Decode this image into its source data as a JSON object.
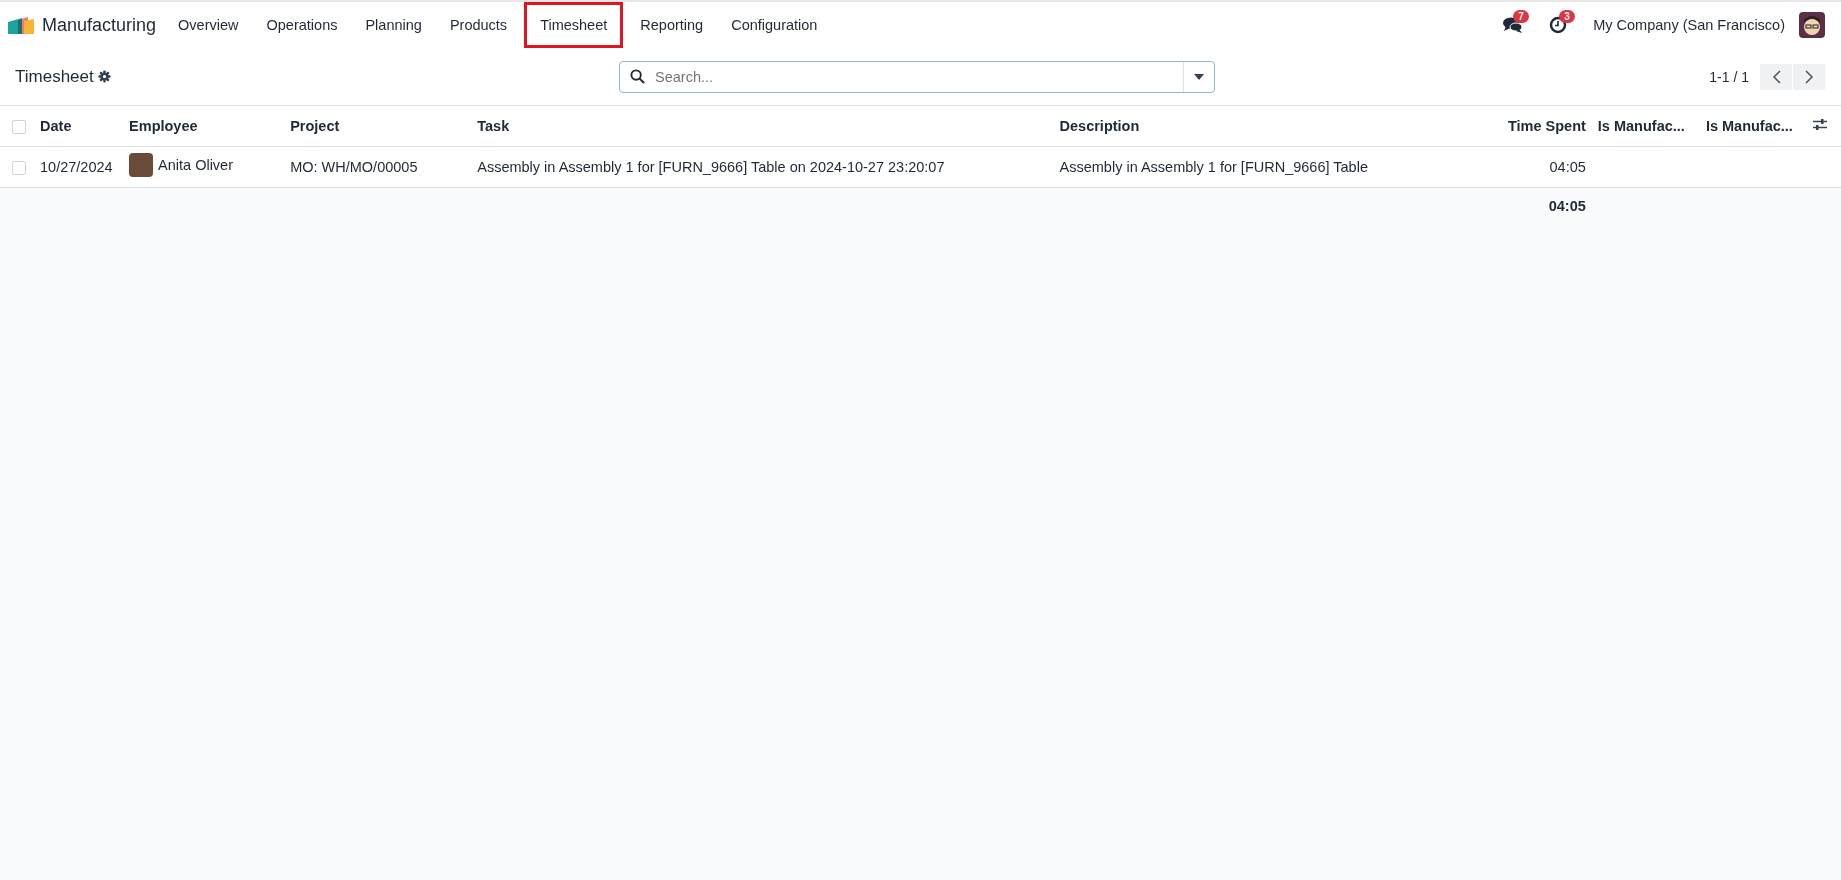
{
  "navbar": {
    "app_name": "Manufacturing",
    "menu": [
      {
        "label": "Overview",
        "highlighted": false
      },
      {
        "label": "Operations",
        "highlighted": false
      },
      {
        "label": "Planning",
        "highlighted": false
      },
      {
        "label": "Products",
        "highlighted": false
      },
      {
        "label": "Timesheet",
        "highlighted": true
      },
      {
        "label": "Reporting",
        "highlighted": false
      },
      {
        "label": "Configuration",
        "highlighted": false
      }
    ],
    "messages_badge": "7",
    "activities_badge": "3",
    "company": "My Company (San Francisco)"
  },
  "control_panel": {
    "title": "Timesheet",
    "search": {
      "placeholder": "Search..."
    },
    "pager": "1-1 / 1"
  },
  "table": {
    "columns": [
      {
        "label": "Date",
        "kind": "text"
      },
      {
        "label": "Employee",
        "kind": "text"
      },
      {
        "label": "Project",
        "kind": "text"
      },
      {
        "label": "Task",
        "kind": "text"
      },
      {
        "label": "Description",
        "kind": "text"
      },
      {
        "label": "Time Spent",
        "kind": "duration"
      },
      {
        "label": "Is Manufac...",
        "kind": "text"
      },
      {
        "label": "Is Manufac...",
        "kind": "text"
      }
    ],
    "all_selected": false,
    "rows": [
      {
        "checked": false,
        "date": "10/27/2024",
        "employee": "Anita Oliver",
        "project": "MO: WH/MO/00005",
        "task": "Assembly in Assembly 1 for [FURN_9666] Table on 2024-10-27 23:20:07",
        "description": "Assembly in Assembly 1 for [FURN_9666] Table",
        "time_spent": "04:05"
      }
    ],
    "total_time_spent": "04:05"
  }
}
